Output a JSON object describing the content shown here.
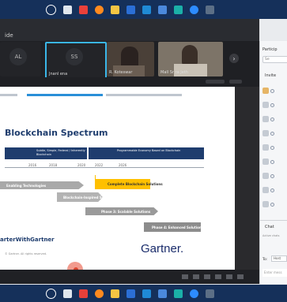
{
  "taskbar_icons": [
    "start-icon",
    "search-icon",
    "task-view-icon",
    "chrome-icon",
    "firefox-icon",
    "file-explorer-icon",
    "store-icon",
    "mail-icon",
    "calendar-icon",
    "edge-icon",
    "teams-icon",
    "settings-icon"
  ],
  "topbar": {
    "title": "ide"
  },
  "participants": [
    {
      "initials": "AL",
      "name": ""
    },
    {
      "initials": "SS",
      "name": "Jnanl ena"
    },
    {
      "initials": "",
      "name": "R. Koteswar"
    },
    {
      "initials": "",
      "name": "Mall Sr ra Jeth"
    }
  ],
  "slide": {
    "title": "Blockchain Spectrum",
    "header_left": "Subtle, Simple, Federal / Inherently Blockchain",
    "header_right": "Programmable Economy Based on Blockchain",
    "years": [
      "2016",
      "2018",
      "2020",
      "2022",
      "2026"
    ],
    "phases": [
      {
        "label": "Enabling Technologies",
        "color": "#a9a9a9"
      },
      {
        "label": "Blockchain-Inspired Solutions",
        "color": "#b3b3b3"
      },
      {
        "label": "Complete Blockchain Solutions",
        "color": "#ffc000"
      },
      {
        "label": "Phase 3: Scalable Solutions",
        "color": "#9a9a9a"
      },
      {
        "label": "Phase 4: Enhanced Solutions",
        "color": "#8c8c8c"
      }
    ],
    "twitter": "arterWithGartner",
    "footer": "© Gartner. All rights reserved.",
    "logo": "Gartner."
  },
  "panel": {
    "participants_label": "Particip",
    "search_placeholder": "Se",
    "section_label": "Invite",
    "chat_label": "Chat",
    "chat_subtext": "Active chats",
    "to_label": "To:",
    "to_value": "Host",
    "message_placeholder": "Enter mess"
  },
  "colors": {
    "taskbar": "#15305a",
    "slide_bar": "#2a8fd8",
    "header_bar": "#1f3d6e",
    "logo": "#1a2c6b"
  }
}
